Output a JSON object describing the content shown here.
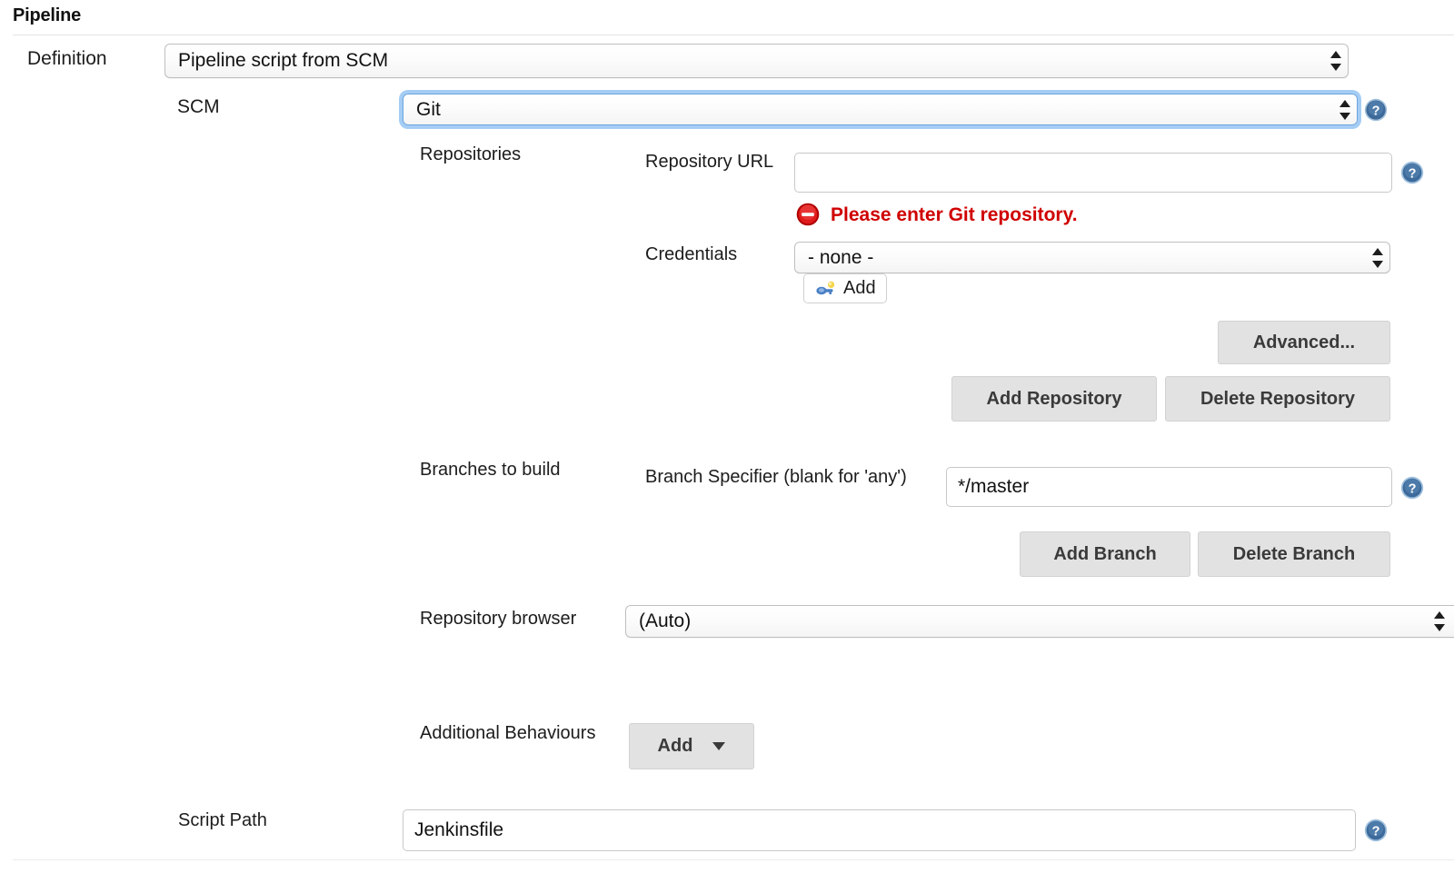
{
  "section": {
    "title": "Pipeline"
  },
  "definition": {
    "label": "Definition",
    "value": "Pipeline script from SCM"
  },
  "scm": {
    "label": "SCM",
    "value": "Git",
    "help_icon": "help-icon"
  },
  "repositories": {
    "label": "Repositories",
    "repository_url": {
      "label": "Repository URL",
      "value": "",
      "placeholder": "",
      "help_icon": "help-icon"
    },
    "error": {
      "icon": "error-no-entry-icon",
      "text": "Please enter Git repository."
    },
    "credentials": {
      "label": "Credentials",
      "value": "- none -",
      "add_button": {
        "label": "Add",
        "icon": "key-icon"
      }
    },
    "advanced_button": "Advanced...",
    "add_repository_button": "Add Repository",
    "delete_repository_button": "Delete Repository"
  },
  "branches": {
    "label": "Branches to build",
    "branch_specifier": {
      "label": "Branch Specifier (blank for 'any')",
      "value": "*/master",
      "help_icon": "help-icon"
    },
    "add_branch_button": "Add Branch",
    "delete_branch_button": "Delete Branch"
  },
  "repository_browser": {
    "label": "Repository browser",
    "value": "(Auto)"
  },
  "additional_behaviours": {
    "label": "Additional Behaviours",
    "add_button": "Add",
    "caret_icon": "chevron-down-icon"
  },
  "script_path": {
    "label": "Script Path",
    "value": "Jenkinsfile",
    "help_icon": "help-icon"
  },
  "colors": {
    "error_red": "#cf0000",
    "focus_blue": "#6eaeee",
    "help_blue": "#37618f",
    "button_gray": "#e2e2e2"
  }
}
